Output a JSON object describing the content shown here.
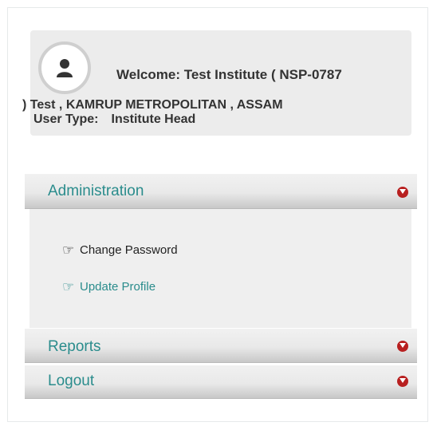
{
  "user": {
    "welcome_line": "Welcome: Test Institute ( NSP-0787",
    "address_line": ") Test , KAMRUP METROPOLITAN , ASSAM",
    "user_type_label": "User Type:",
    "user_type_value": "Institute Head"
  },
  "menu": {
    "administration": {
      "label": "Administration",
      "toggle_icon": "chevron-down-circle-icon"
    },
    "administration_items": [
      {
        "label": "Change Password",
        "icon": "hand-pointer-icon"
      },
      {
        "label": "Update Profile",
        "icon": "hand-pointer-icon"
      }
    ],
    "reports": {
      "label": "Reports",
      "toggle_icon": "chevron-down-circle-icon"
    },
    "logout": {
      "label": "Logout",
      "toggle_icon": "chevron-down-circle-icon"
    }
  },
  "colors": {
    "accent_teal": "#2a8c8c",
    "toggle_red": "#b82020",
    "card_bg": "#ececec"
  }
}
